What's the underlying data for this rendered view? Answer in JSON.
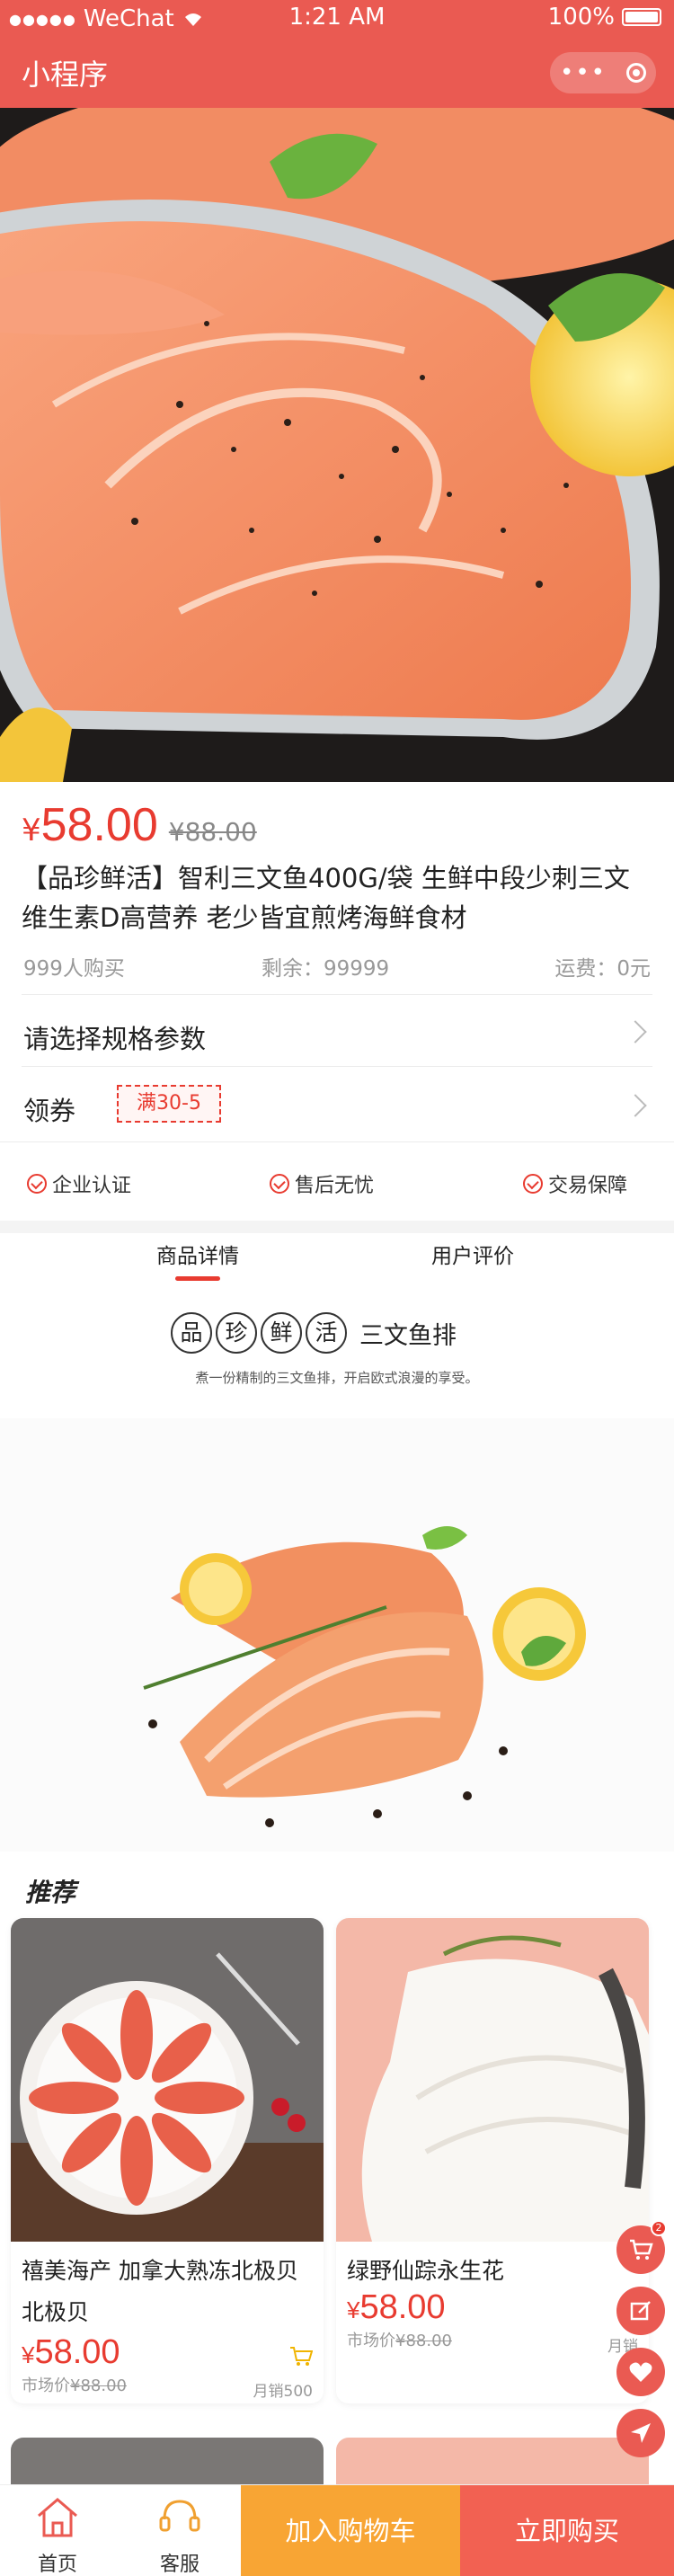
{
  "status_bar": {
    "signal": "●●●●●",
    "carrier": "WeChat",
    "time": "1:21 AM",
    "battery": "100%"
  },
  "nav": {
    "title": "小程序",
    "more": "•••"
  },
  "product": {
    "currency": "¥",
    "price": "58.00",
    "old_price": "¥88.00",
    "title": "【品珍鲜活】智利三文鱼400G/袋 生鲜中段少刺三文维生素D高营养 老少皆宜煎烤海鲜食材",
    "sold": "999人购买",
    "stock": "剩余：99999",
    "shipping": "运费：0元"
  },
  "spec_row": {
    "label": "请选择规格参数"
  },
  "coupon_row": {
    "label": "领券",
    "coupon": "满30-5"
  },
  "guarantees": [
    "企业认证",
    "售后无忧",
    "交易保障"
  ],
  "tabs": [
    "商品详情",
    "用户评价"
  ],
  "brand": {
    "chars": [
      "品",
      "珍",
      "鲜",
      "活"
    ],
    "product": "三文鱼排",
    "subtitle": "煮一份精制的三文鱼排，开启欧式浪漫的享受。"
  },
  "recommend": {
    "title": "推荐",
    "items": [
      {
        "name": "禧美海产 加拿大熟冻北极贝北极贝",
        "currency": "¥",
        "price": "58.00",
        "market_label": "市场价",
        "market_price": "¥88.00",
        "sales": "月销500"
      },
      {
        "name": "绿野仙踪永生花",
        "currency": "¥",
        "price": "58.00",
        "market_label": "市场价",
        "market_price": "¥88.00",
        "sales": "月销"
      }
    ]
  },
  "floating": {
    "badge": "2"
  },
  "bottom": {
    "home": "首页",
    "service": "客服",
    "add_cart": "加入购物车",
    "buy_now": "立即购买"
  },
  "colors": {
    "primary": "#ea5a52",
    "price": "#e83b30",
    "cart_button": "#f8a534",
    "buy_button": "#f26152"
  }
}
